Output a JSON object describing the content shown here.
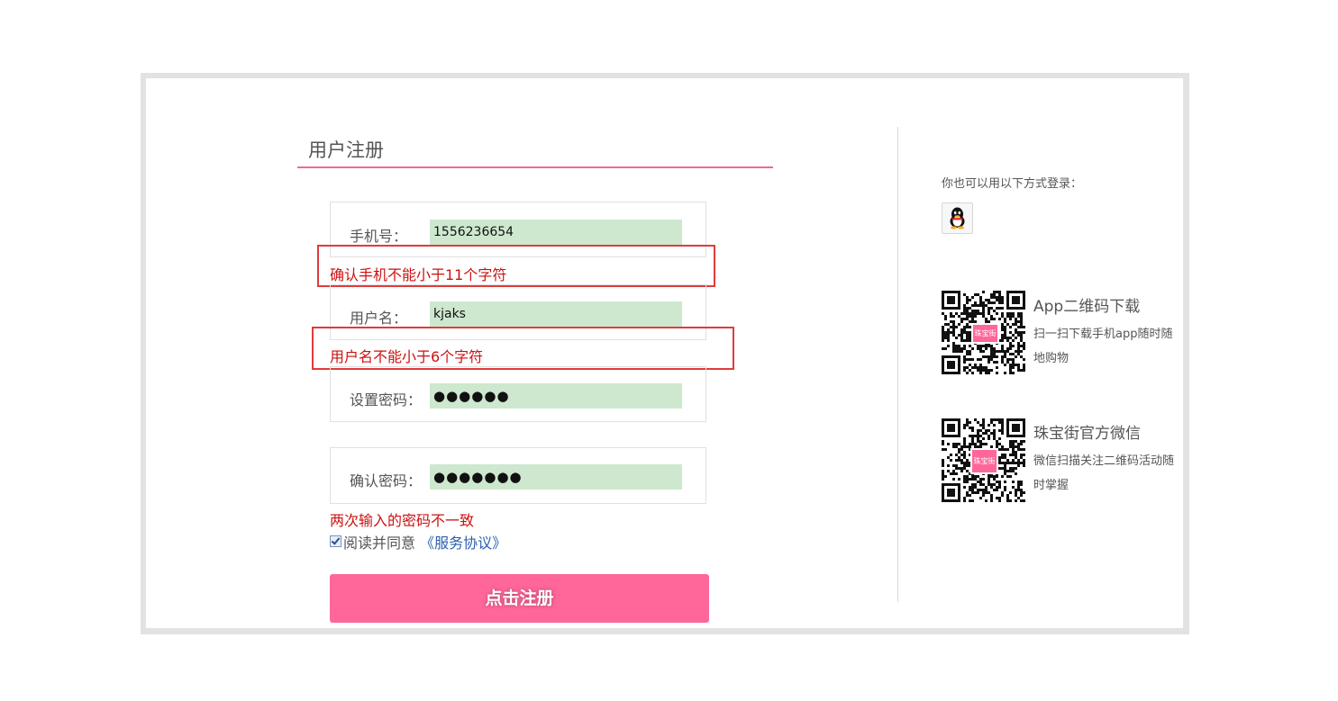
{
  "register": {
    "title": "用户注册",
    "phone": {
      "label": "手机号：",
      "value": "1556236654",
      "error": "确认手机不能小于11个字符"
    },
    "username": {
      "label": "用户名：",
      "value": "kjaks",
      "error": "用户名不能小于6个字符"
    },
    "password": {
      "label": "设置密码：",
      "value": "●●●●●●"
    },
    "confirm": {
      "label": "确认密码：",
      "value": "●●●●●●●",
      "error": "两次输入的密码不一致"
    },
    "agree": {
      "checked": true,
      "text": "阅读并同意",
      "link": "《服务协议》"
    },
    "submit_label": "点击注册"
  },
  "side": {
    "alt_login_text": "你也可以用以下方式登录：",
    "qq_icon": "qq-penguin-icon",
    "app": {
      "title": "App二维码下载",
      "desc": "扫一扫下载手机app随时随地购物",
      "badge": "珠宝街"
    },
    "wechat": {
      "title": "珠宝街官方微信",
      "desc": "微信扫描关注二维码活动随时掌握",
      "badge": "珠宝街"
    }
  },
  "colors": {
    "accent": "#ff6699",
    "error": "#cc1111",
    "input_bg": "#cde8cf",
    "link": "#2a5fae"
  }
}
